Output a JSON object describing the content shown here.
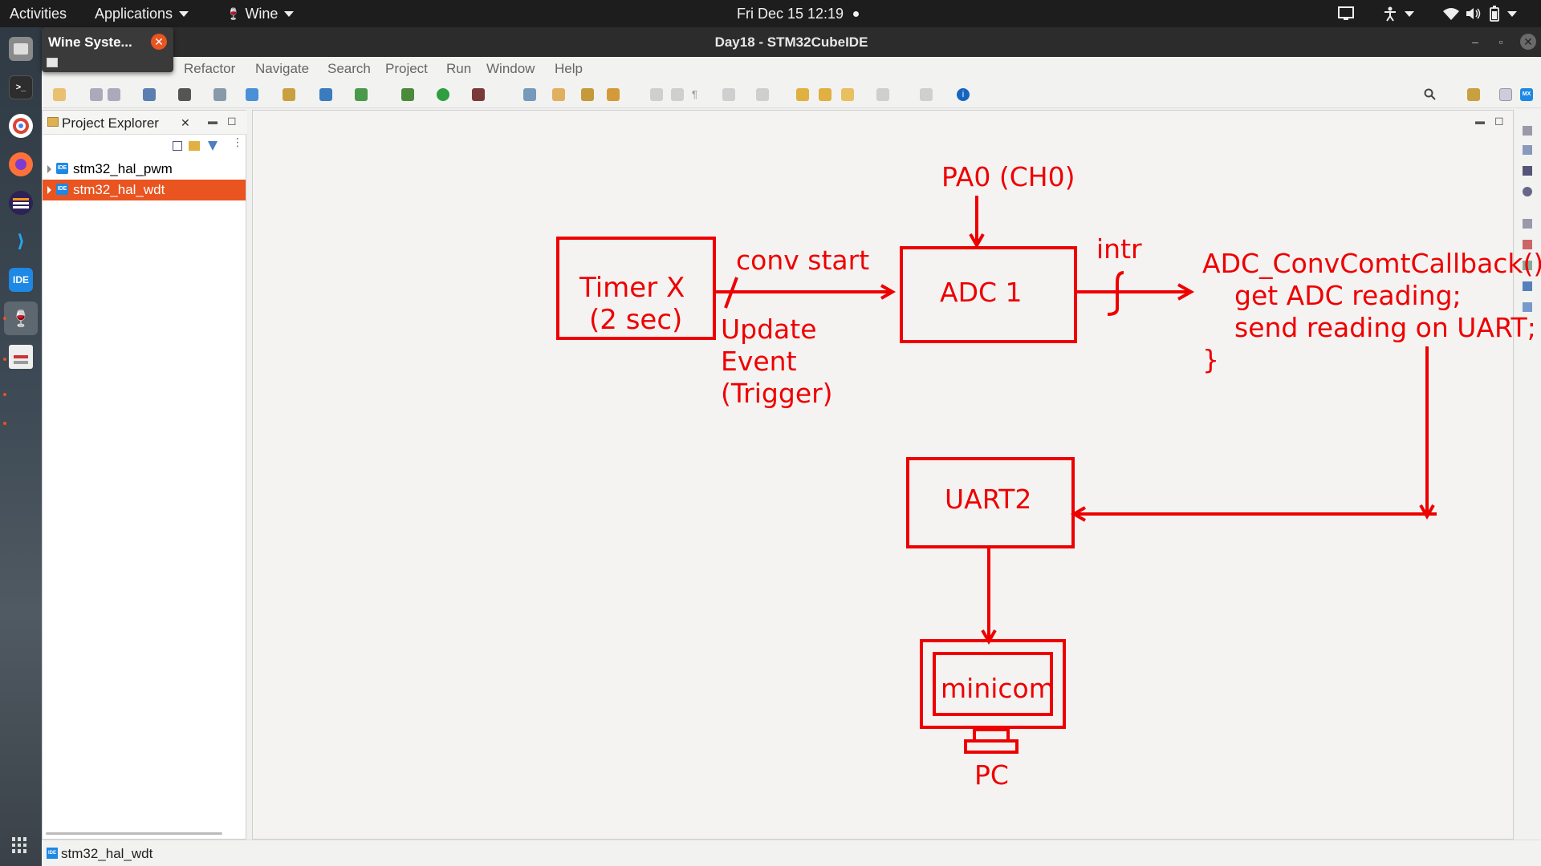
{
  "topbar": {
    "activities": "Activities",
    "applications": "Applications",
    "wine": "Wine",
    "clock": "Fri Dec 15  12:19"
  },
  "dock": {
    "items": [
      {
        "icon": "files-icon"
      },
      {
        "icon": "terminal-icon"
      },
      {
        "icon": "chrome-icon"
      },
      {
        "icon": "firefox-icon"
      },
      {
        "icon": "eclipse-icon"
      },
      {
        "icon": "vscode-icon"
      },
      {
        "icon": "stm32cubeide-icon",
        "label": "IDE"
      },
      {
        "icon": "wine-icon"
      },
      {
        "icon": "document-viewer-icon"
      }
    ]
  },
  "wine_popup": {
    "title": "Wine Syste...",
    "close_glyph": "✕"
  },
  "window": {
    "title": "Day18 - STM32CubeIDE"
  },
  "menu": {
    "items": [
      "Refactor",
      "Navigate",
      "Search",
      "Project",
      "Run",
      "Window",
      "Help"
    ]
  },
  "explorer": {
    "tab_label": "Project Explorer",
    "close_glyph": "✕",
    "projects": [
      {
        "name": "stm32_hal_pwm",
        "selected": false
      },
      {
        "name": "stm32_hal_wdt",
        "selected": true
      }
    ]
  },
  "statusbar": {
    "text": "stm32_hal_wdt"
  },
  "diagram": {
    "timer_line1": "Timer X",
    "timer_line2": "(2 sec)",
    "conv_start": "conv start",
    "update_line1": "Update",
    "update_line2": "Event",
    "update_line3": "(Trigger)",
    "pa0": "PA0 (CH0)",
    "adc": "ADC 1",
    "intr": "intr",
    "callback_line1": "ADC_ConvComtCallback() {",
    "callback_line2": "get ADC reading;",
    "callback_line3": "send reading on UART;",
    "callback_line4": "}",
    "uart": "UART2",
    "minicom": "minicom",
    "pc": "PC",
    "color": "#ee0000"
  }
}
